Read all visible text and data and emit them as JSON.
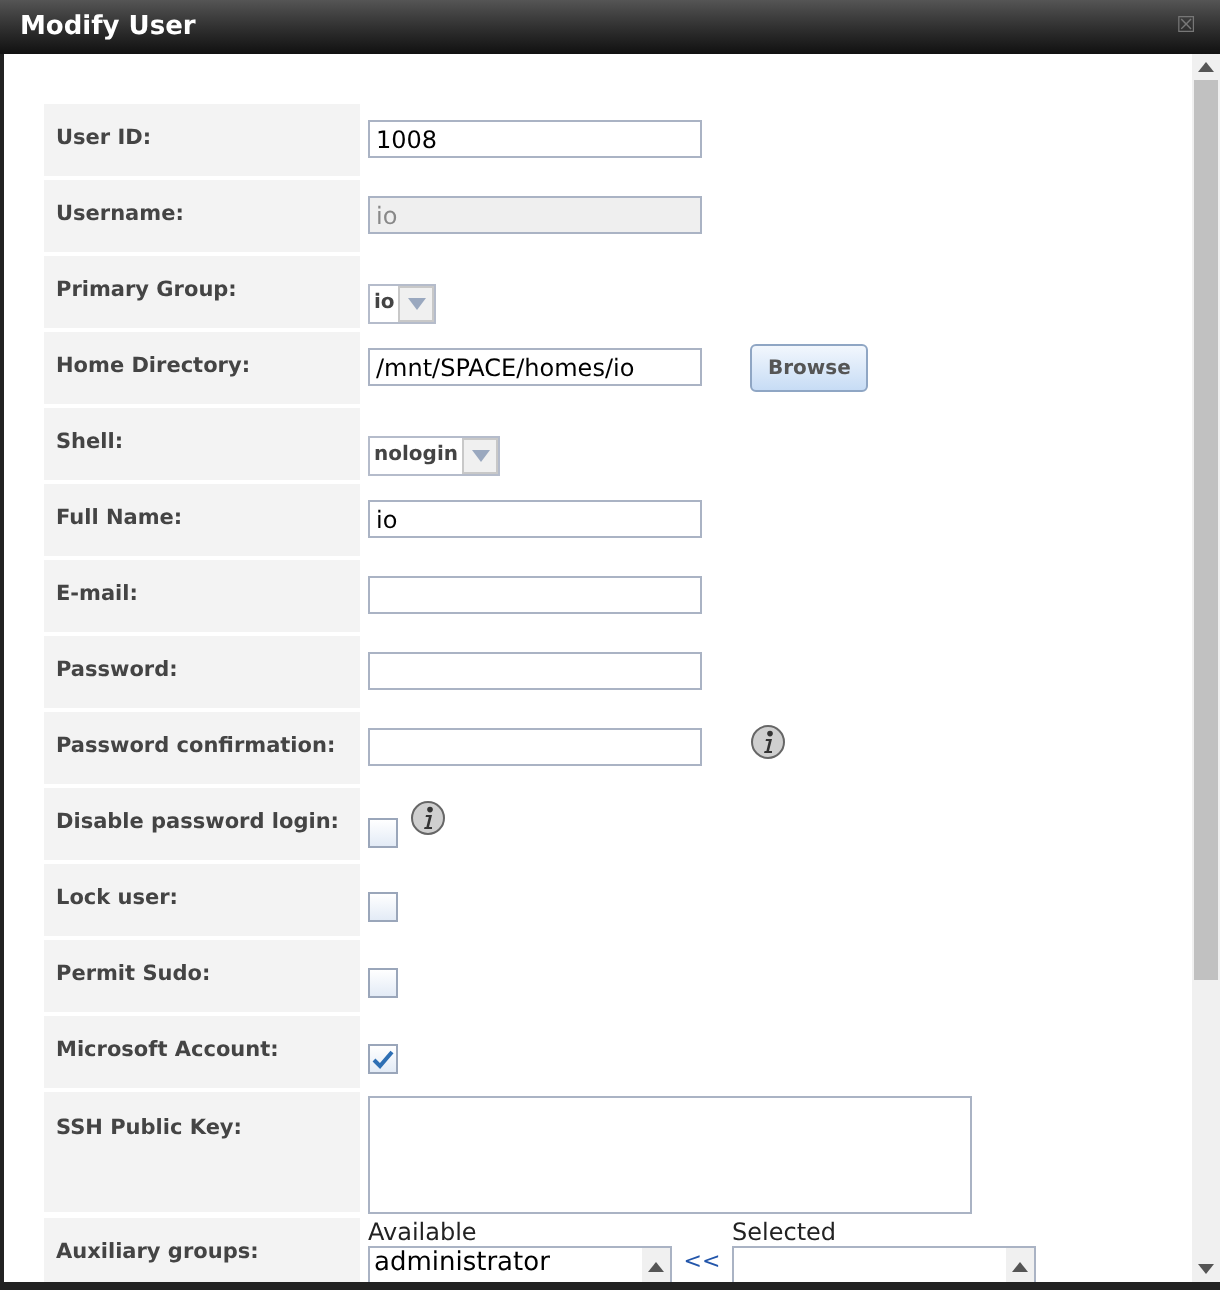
{
  "window": {
    "title": "Modify User",
    "close": "☒"
  },
  "fields": [
    {
      "kind": "text",
      "label": "User ID:",
      "value": "1008",
      "disabled": false
    },
    {
      "kind": "text",
      "label": "Username:",
      "value": "io",
      "disabled": true
    },
    {
      "kind": "select",
      "label": "Primary Group:",
      "value": "io"
    },
    {
      "kind": "text",
      "label": "Home Directory:",
      "value": "/mnt/SPACE/homes/io",
      "disabled": false,
      "button": "Browse"
    },
    {
      "kind": "select",
      "label": "Shell:",
      "value": "nologin"
    },
    {
      "kind": "text",
      "label": "Full Name:",
      "value": "io",
      "disabled": false
    },
    {
      "kind": "text",
      "label": "E-mail:",
      "disabled": false
    },
    {
      "kind": "text",
      "label": "Password:",
      "disabled": false
    },
    {
      "kind": "text",
      "label": "Password confirmation:",
      "disabled": false,
      "info": true
    },
    {
      "kind": "checkbox",
      "label": "Disable password login:",
      "checked": false,
      "info": true
    },
    {
      "kind": "checkbox",
      "label": "Lock user:",
      "checked": false
    },
    {
      "kind": "checkbox",
      "label": "Permit Sudo:",
      "checked": false
    },
    {
      "kind": "checkbox",
      "label": "Microsoft Account:",
      "checked": true
    },
    {
      "kind": "textarea",
      "label": "SSH Public Key:"
    },
    {
      "kind": "groups",
      "label": "Auxiliary groups:",
      "available_label": "Available",
      "available": [
        "administrator"
      ],
      "move": "<<",
      "selected_label": "Selected"
    }
  ]
}
